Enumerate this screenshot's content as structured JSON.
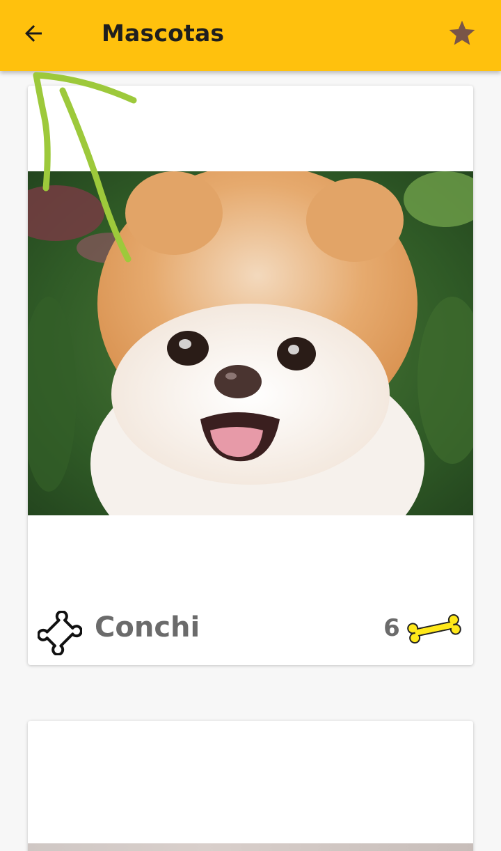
{
  "toolbar": {
    "title": "Mascotas",
    "back_icon": "arrow-back-icon",
    "favorite_icon": "star-icon",
    "background_color": "#FFC10D",
    "star_color": "#795548"
  },
  "pets": [
    {
      "name": "Conchi",
      "likes": "6",
      "photo_description_icon": "pomeranian-photo",
      "like_icon": "yellow-bone-icon",
      "type_icon": "bone-outline-icon"
    }
  ],
  "annotation": {
    "icon": "hand-drawn-green-arrow",
    "color": "#9DC93B"
  }
}
